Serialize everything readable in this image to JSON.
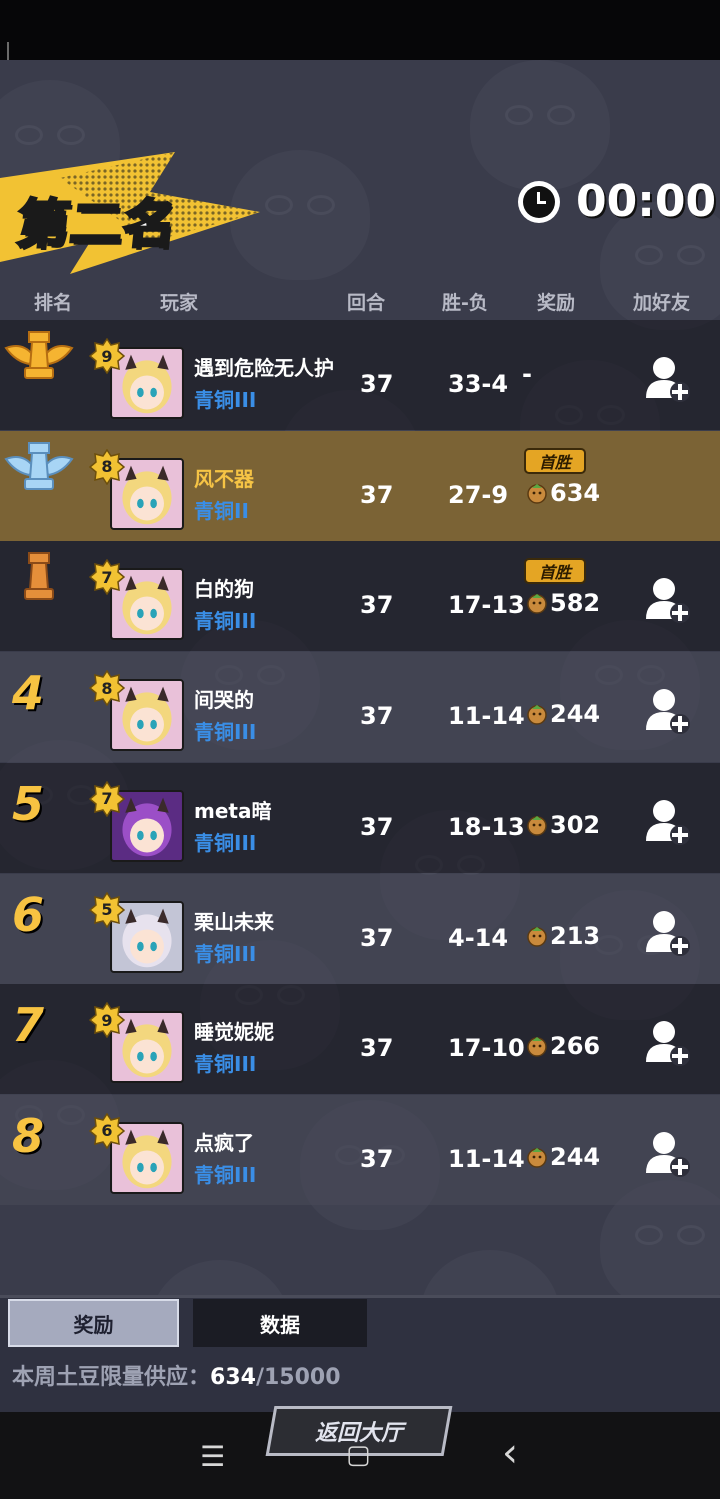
{
  "title": "第二名",
  "timer": "00:00",
  "headers": {
    "rank": "排名",
    "player": "玩家",
    "rounds": "回合",
    "wl": "胜-负",
    "reward": "奖励",
    "add_friend": "加好友"
  },
  "players": [
    {
      "rank": "",
      "trophy": "gold",
      "level": "9",
      "name": "遇到危险无人护",
      "tier": "青铜III",
      "rounds": "37",
      "wl": "33-4",
      "reward": "-",
      "first_win": "",
      "highlight": false,
      "name_color": "#ffffff"
    },
    {
      "rank": "",
      "trophy": "silver",
      "level": "8",
      "name": "风不器",
      "tier": "青铜II",
      "rounds": "37",
      "wl": "27-9",
      "reward": "634",
      "first_win": "首胜",
      "highlight": true,
      "name_color": "#f6c445"
    },
    {
      "rank": "",
      "trophy": "bronze",
      "level": "7",
      "name": "白的狗",
      "tier": "青铜III",
      "rounds": "37",
      "wl": "17-13",
      "reward": "582",
      "first_win": "首胜",
      "highlight": false,
      "name_color": "#ffffff"
    },
    {
      "rank": "4",
      "trophy": "",
      "level": "8",
      "name": "间哭的",
      "tier": "青铜III",
      "rounds": "37",
      "wl": "11-14",
      "reward": "244",
      "first_win": "",
      "highlight": false,
      "name_color": "#ffffff"
    },
    {
      "rank": "5",
      "trophy": "",
      "level": "7",
      "name": "meta暗",
      "tier": "青铜III",
      "rounds": "37",
      "wl": "18-13",
      "reward": "302",
      "first_win": "",
      "highlight": false,
      "name_color": "#ffffff"
    },
    {
      "rank": "6",
      "trophy": "",
      "level": "5",
      "name": "栗山未来",
      "tier": "青铜III",
      "rounds": "37",
      "wl": "4-14",
      "reward": "213",
      "first_win": "",
      "highlight": false,
      "name_color": "#ffffff"
    },
    {
      "rank": "7",
      "trophy": "",
      "level": "9",
      "name": "睡觉妮妮",
      "tier": "青铜III",
      "rounds": "37",
      "wl": "17-10",
      "reward": "266",
      "first_win": "",
      "highlight": false,
      "name_color": "#ffffff"
    },
    {
      "rank": "8",
      "trophy": "",
      "level": "6",
      "name": "点疯了",
      "tier": "青铜III",
      "rounds": "37",
      "wl": "11-14",
      "reward": "244",
      "first_win": "",
      "highlight": false,
      "name_color": "#ffffff"
    }
  ],
  "tabs": {
    "reward": "奖励",
    "data": "数据"
  },
  "supply": {
    "label": "本周土豆限量供应：",
    "current": "634",
    "max": "/15000"
  },
  "return_label": "返回大厅",
  "nav": {
    "menu": "☰",
    "home": "▢",
    "back": "‹"
  }
}
